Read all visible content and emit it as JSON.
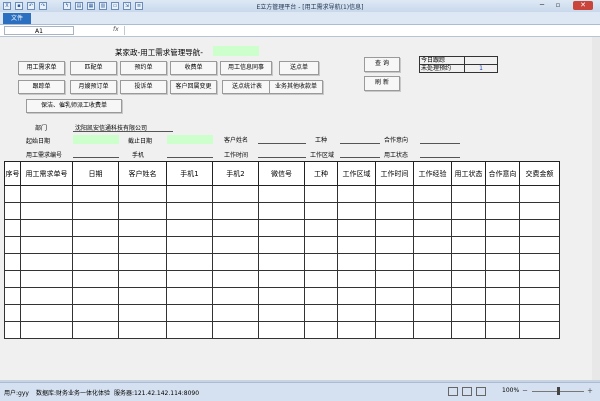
{
  "window": {
    "title": "E立方管理平台 - [用工需求导航(1)信息]",
    "file_tab": "文件",
    "controls": {
      "minimize": "─",
      "restore": "▫",
      "close": "✕"
    }
  },
  "formula": {
    "cell_ref": "A1",
    "fx": "fx"
  },
  "header": {
    "title": "某家政-用工需求管理导航-",
    "buttons": {
      "row1": [
        "用工需求单",
        "匹配单",
        "预约单",
        "收费单",
        "用工信息同事",
        "送点单"
      ],
      "row2": [
        "跟踪单",
        "月嫂预订单",
        "投诉单",
        "客户回属变更",
        "送点统计表",
        "业务其他收款单"
      ],
      "row3": "保洁、催乳师派工收费单",
      "query": "查 询",
      "refresh": "刷 新"
    },
    "today_table": {
      "row1_label": "今日跟踪",
      "row2_label": "未处理预约",
      "row2_value": "1"
    }
  },
  "filters": {
    "dept_label": "部门",
    "dept_value": "沈阳凯安信通科技有限公司",
    "start_date": "起始日期",
    "end_date": "截止日期",
    "customer_name": "客户姓名",
    "job_type": "工种",
    "intent": "合作意向",
    "demand_no": "用工需求编号",
    "mobile": "手机",
    "work_time": "工作时间",
    "work_area": "工作区域",
    "work_status": "用工状态"
  },
  "grid": {
    "columns": [
      "序号",
      "用工需求单号",
      "日期",
      "客户姓名",
      "手机1",
      "手机2",
      "微信号",
      "工种",
      "工作区域",
      "工作时间",
      "工作经验",
      "用工状态",
      "合作意向",
      "交费金额"
    ],
    "row_count": 9
  },
  "status": {
    "user": "用户:gyy",
    "product": "数据库:财务业务一体化体验",
    "server": "服务器:121.42.142.114:8090",
    "zoom": "100%",
    "zoom_minus": "－",
    "zoom_plus": "＋"
  }
}
